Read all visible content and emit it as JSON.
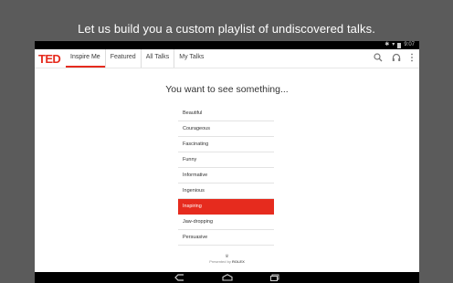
{
  "promo": {
    "caption": "Let us build you a custom playlist of undiscovered talks."
  },
  "status_bar": {
    "time": "9:07"
  },
  "app": {
    "logo": "TED",
    "tabs": [
      {
        "label": "Inspire Me",
        "active": true
      },
      {
        "label": "Featured",
        "active": false
      },
      {
        "label": "All Talks",
        "active": false
      },
      {
        "label": "My Talks",
        "active": false
      }
    ],
    "actions": [
      "search-icon",
      "headphones-icon",
      "overflow-menu-icon"
    ]
  },
  "inspire": {
    "prompt": "You want to see something...",
    "moods": [
      {
        "label": "Beautiful",
        "selected": false
      },
      {
        "label": "Courageous",
        "selected": false
      },
      {
        "label": "Fascinating",
        "selected": false
      },
      {
        "label": "Funny",
        "selected": false
      },
      {
        "label": "Informative",
        "selected": false
      },
      {
        "label": "Ingenious",
        "selected": false
      },
      {
        "label": "Inspiring",
        "selected": true
      },
      {
        "label": "Jaw-dropping",
        "selected": false
      },
      {
        "label": "Persuasive",
        "selected": false
      }
    ],
    "sponsor_prefix": "Presented by",
    "sponsor_name": "ROLEX"
  },
  "colors": {
    "accent": "#e62b1e",
    "outer_background": "#5b5b5b"
  },
  "nav_bar": {
    "buttons": [
      "back-icon",
      "home-icon",
      "recents-icon"
    ]
  }
}
